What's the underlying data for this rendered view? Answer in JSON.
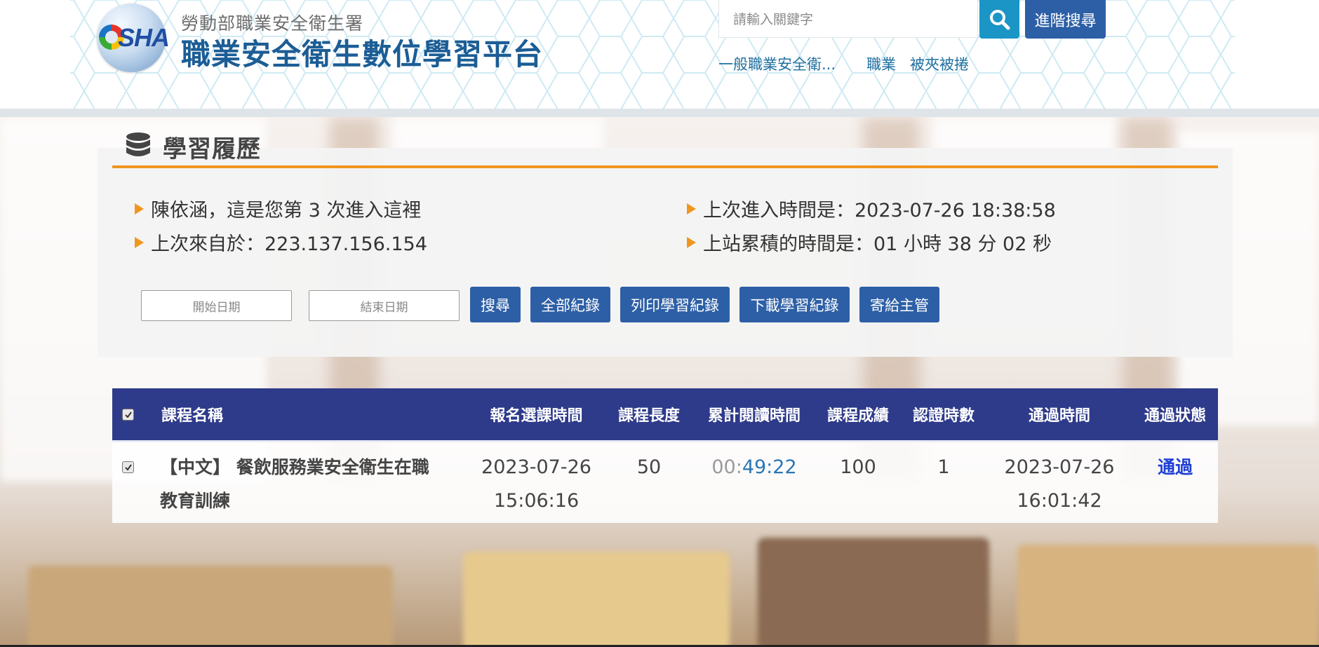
{
  "header": {
    "ministry": "勞動部職業安全衛生署",
    "platform": "職業安全衛生數位學習平台",
    "logo_text": "SHA",
    "search": {
      "placeholder": "請輸入關鍵字"
    },
    "advanced_search_label": "進階搜尋",
    "hot_keywords": [
      "一般職業安全衛...",
      "職業",
      "被夾被捲"
    ]
  },
  "panel": {
    "title": "學習履歷",
    "info": {
      "welcome": "陳依涵，這是您第 3 次進入這裡",
      "last_ip": "上次來自於：223.137.156.154",
      "last_login": "上次進入時間是：2023-07-26 18:38:58",
      "total_time": "上站累積的時間是：01 小時 38 分 02 秒"
    },
    "filters": {
      "start_date_placeholder": "開始日期",
      "end_date_placeholder": "結束日期"
    },
    "buttons": {
      "search": "搜尋",
      "all_records": "全部紀錄",
      "print_records": "列印學習紀錄",
      "download_records": "下載學習紀錄",
      "send_to_supervisor": "寄給主管"
    }
  },
  "table": {
    "headers": {
      "course_name": "課程名稱",
      "enroll_time": "報名選課時間",
      "course_length": "課程長度",
      "reading_time": "累計閱讀時間",
      "score": "課程成績",
      "cert_hours": "認證時數",
      "pass_time": "通過時間",
      "pass_status": "通過狀態"
    },
    "rows": [
      {
        "checked": true,
        "course_name_line1": "【中文】 餐飲服務業安全衛生在職",
        "course_name_line2": "教育訓練",
        "enroll_date": "2023-07-26",
        "enroll_clock": "15:06:16",
        "course_length": "50",
        "reading_hours": "00:",
        "reading_minsec": "49:22",
        "score": "100",
        "cert_hours": "1",
        "pass_date": "2023-07-26",
        "pass_clock": "16:01:42",
        "pass_status": "通過"
      }
    ]
  },
  "colors": {
    "accent_orange": "#f0961f",
    "button_blue": "#2d5fa6",
    "table_header": "#2e3a8a",
    "status_pass": "#1f3fd6"
  }
}
